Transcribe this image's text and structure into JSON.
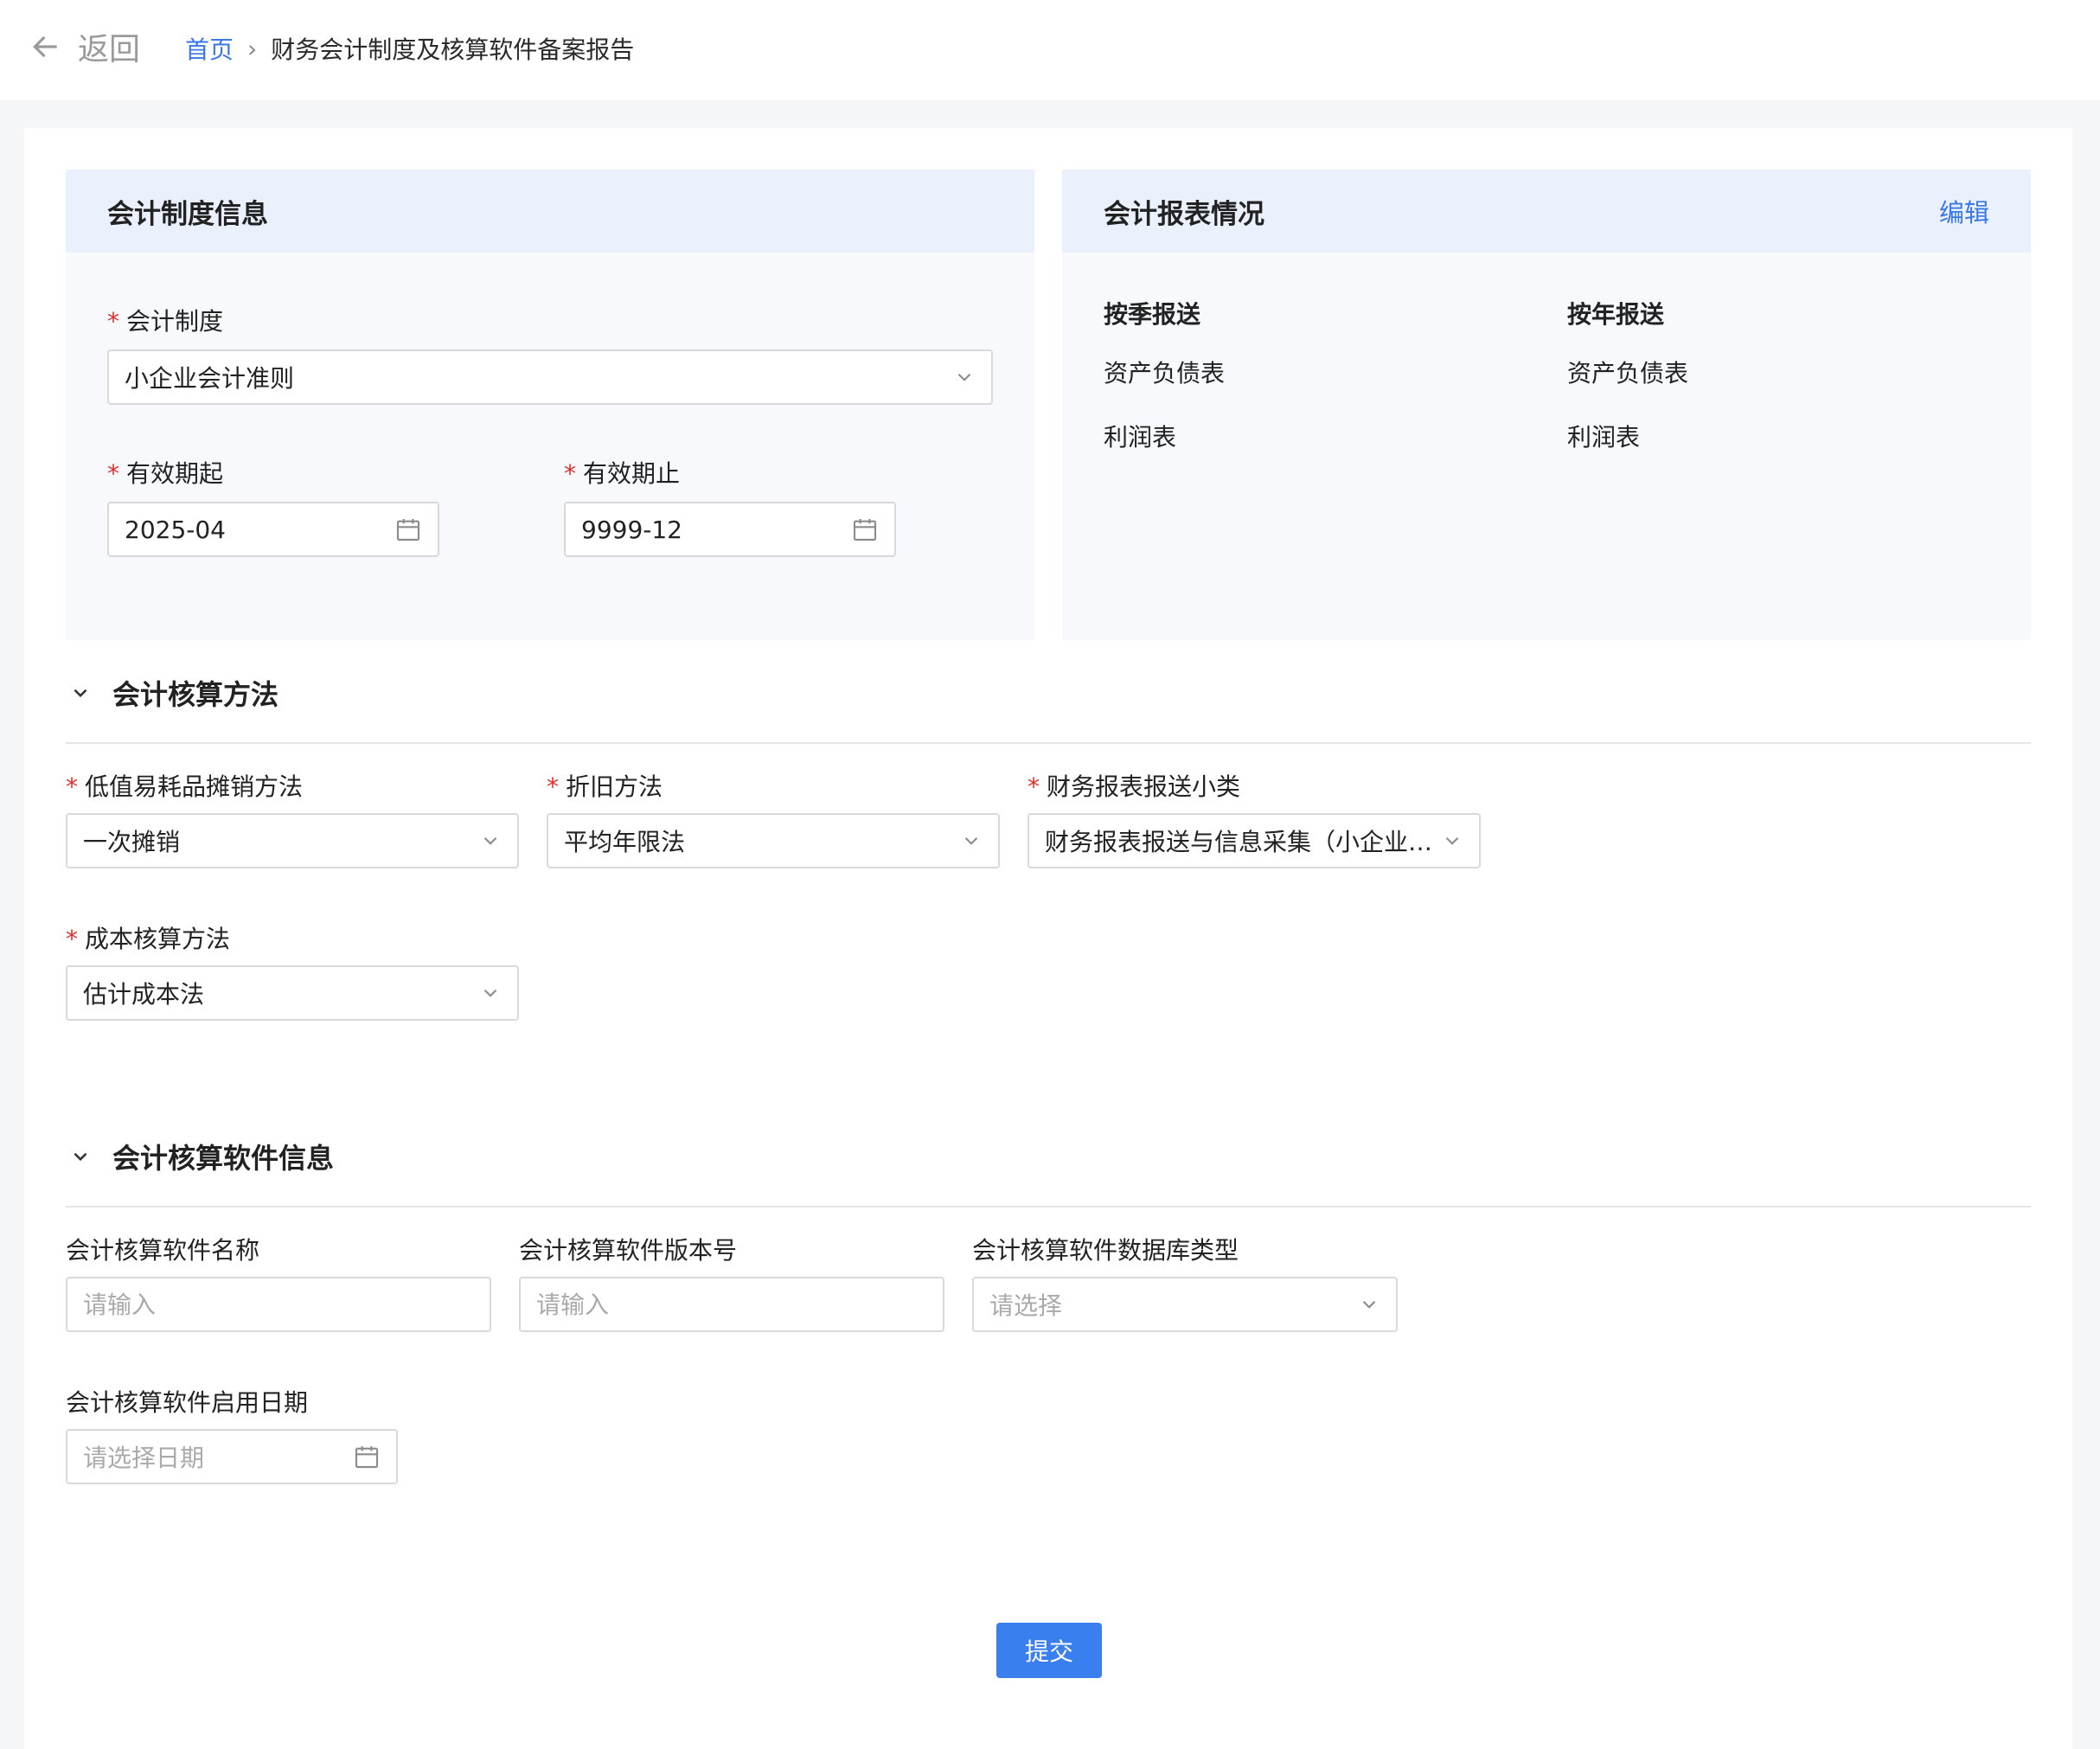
{
  "header": {
    "back_label": "返回",
    "breadcrumb": {
      "home": "首页",
      "current": "财务会计制度及核算软件备案报告"
    }
  },
  "accounting_system": {
    "title": "会计制度信息",
    "system_label": "会计制度",
    "system_value": "小企业会计准则",
    "start_label": "有效期起",
    "start_value": "2025-04",
    "end_label": "有效期止",
    "end_value": "9999-12"
  },
  "reports": {
    "title": "会计报表情况",
    "edit_label": "编辑",
    "quarterly": {
      "title": "按季报送",
      "items": [
        "资产负债表",
        "利润表"
      ]
    },
    "annual": {
      "title": "按年报送",
      "items": [
        "资产负债表",
        "利润表"
      ]
    }
  },
  "methods": {
    "title": "会计核算方法",
    "low_value_label": "低值易耗品摊销方法",
    "low_value_value": "一次摊销",
    "depreciation_label": "折旧方法",
    "depreciation_value": "平均年限法",
    "report_category_label": "财务报表报送小类",
    "report_category_value": "财务报表报送与信息采集（小企业会计准则）",
    "cost_label": "成本核算方法",
    "cost_value": "估计成本法"
  },
  "software": {
    "title": "会计核算软件信息",
    "name_label": "会计核算软件名称",
    "name_placeholder": "请输入",
    "version_label": "会计核算软件版本号",
    "version_placeholder": "请输入",
    "db_label": "会计核算软件数据库类型",
    "db_placeholder": "请选择",
    "date_label": "会计核算软件启用日期",
    "date_placeholder": "请选择日期"
  },
  "submit_label": "提交"
}
